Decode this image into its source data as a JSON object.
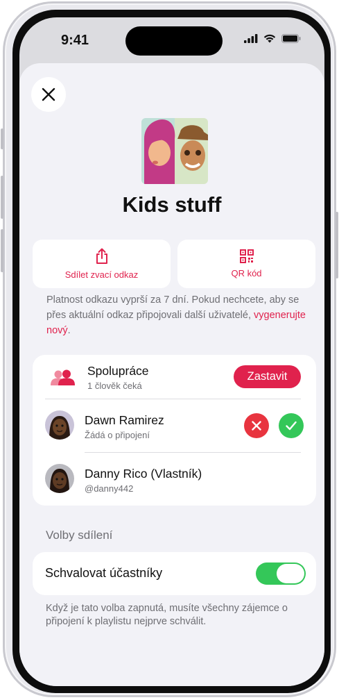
{
  "status_bar": {
    "time": "9:41"
  },
  "playlist": {
    "title": "Kids stuff"
  },
  "actions": {
    "share_label": "Sdílet zvací odkaz",
    "qr_label": "QR kód"
  },
  "info": {
    "text": "Platnost odkazu vyprší za 7 dní. Pokud nechcete, aby se přes aktuální odkaz připojovali další uživatelé,",
    "link": "vygenerujte nový",
    "suffix": "."
  },
  "collaboration": {
    "title": "Spolupráce",
    "subtitle": "1 člověk čeká",
    "stop_label": "Zastavit",
    "members": [
      {
        "name": "Dawn Ramirez",
        "detail": "Žádá o připojení"
      },
      {
        "name": "Danny Rico (Vlastník)",
        "detail": "@danny442"
      }
    ]
  },
  "sharing_options": {
    "header": "Volby sdílení",
    "approve_label": "Schvalovat účastníky",
    "approve_enabled": true,
    "footer": "Když je tato volba zapnutá, musíte všechny zájemce o připojení k playlistu nejprve schválit."
  },
  "colors": {
    "accent": "#e0224d",
    "toggle_on": "#34c759",
    "approve_green": "#34c759",
    "decline_red": "#e8343f"
  },
  "icons": [
    "close-icon",
    "share-icon",
    "qr-code-icon",
    "people-icon",
    "x-mark-icon",
    "checkmark-icon"
  ]
}
